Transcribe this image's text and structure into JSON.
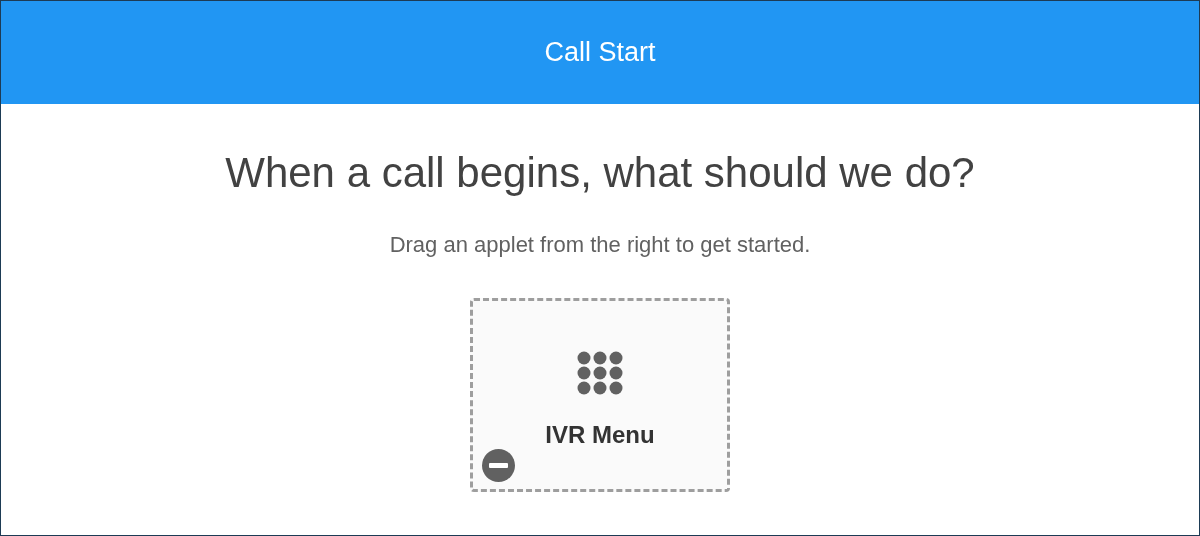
{
  "header": {
    "title": "Call Start"
  },
  "heading": "When a call begins, what should we do?",
  "subtitle": "Drag an applet from the right to get started.",
  "applet": {
    "label": "IVR Menu"
  }
}
